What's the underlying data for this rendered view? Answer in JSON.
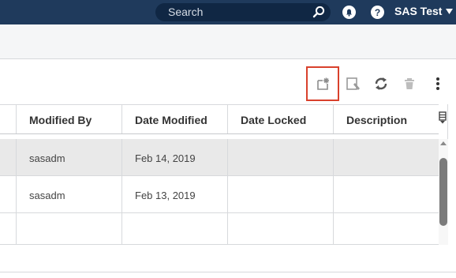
{
  "header": {
    "search_placeholder": "Search",
    "user_name": "SAS Test"
  },
  "toolbar": {
    "icons": [
      "new-item-icon",
      "edit-icon",
      "refresh-icon",
      "delete-icon",
      "more-options-icon"
    ]
  },
  "table": {
    "columns": [
      "Modified By",
      "Date Modified",
      "Date Locked",
      "Description"
    ],
    "rows": [
      {
        "modified_by": "sasadm",
        "date_modified": "Feb 14, 2019",
        "date_locked": "",
        "description": ""
      },
      {
        "modified_by": "sasadm",
        "date_modified": "Feb 13, 2019",
        "date_locked": "",
        "description": ""
      }
    ]
  },
  "colors": {
    "topbar": "#1f3a5c",
    "search_bg": "#102744",
    "highlight": "#d9412c",
    "selected_row": "#e9e9e9"
  }
}
